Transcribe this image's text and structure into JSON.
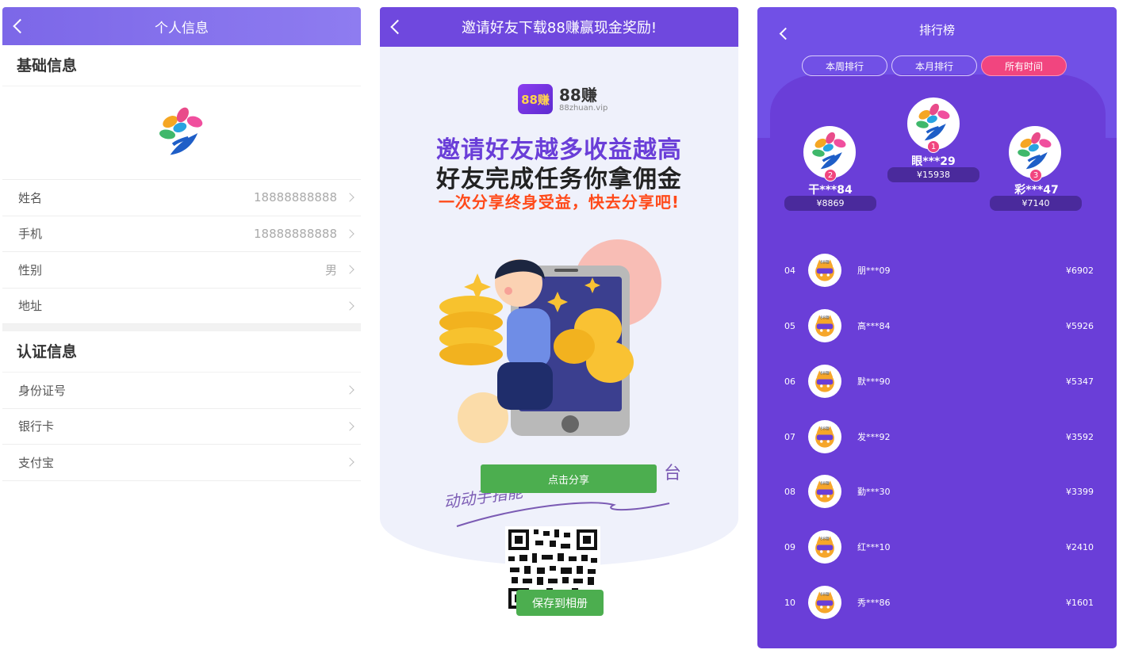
{
  "screen1": {
    "title": "个人信息",
    "basic_section": "基础信息",
    "rows": [
      {
        "label": "姓名",
        "value": "18888888888"
      },
      {
        "label": "手机",
        "value": "18888888888"
      },
      {
        "label": "性别",
        "value": "男"
      },
      {
        "label": "地址",
        "value": ""
      }
    ],
    "auth_section": "认证信息",
    "auth_rows": [
      {
        "label": "身份证号"
      },
      {
        "label": "银行卡"
      },
      {
        "label": "支付宝"
      }
    ]
  },
  "screen2": {
    "title": "邀请好友下载88赚赢现金奖励!",
    "logo_badge": "88赚",
    "logo_name": "88赚",
    "logo_url": "88zhuan.vip",
    "headline1": "邀请好友越多收益越高",
    "headline2": "好友完成任务你拿佣金",
    "headline3": "一次分享终身受益，快去分享吧!",
    "share_button": "点击分享",
    "script_text": "动动手指能",
    "script_tail": "台",
    "save_button": "保存到相册"
  },
  "screen3": {
    "title": "排行榜",
    "tabs": [
      "本周排行",
      "本月排行",
      "所有时间"
    ],
    "active_tab": 2,
    "podium": [
      {
        "rank": "1",
        "name": "眼***29",
        "amount": "¥15938"
      },
      {
        "rank": "2",
        "name": "干***84",
        "amount": "¥8869"
      },
      {
        "rank": "3",
        "name": "彩***47",
        "amount": "¥7140"
      }
    ],
    "list": [
      {
        "rank": "04",
        "name": "朋***09",
        "amount": "¥6902"
      },
      {
        "rank": "05",
        "name": "高***84",
        "amount": "¥5926"
      },
      {
        "rank": "06",
        "name": "默***90",
        "amount": "¥5347"
      },
      {
        "rank": "07",
        "name": "发***92",
        "amount": "¥3592"
      },
      {
        "rank": "08",
        "name": "勤***30",
        "amount": "¥3399"
      },
      {
        "rank": "09",
        "name": "红***10",
        "amount": "¥2410"
      },
      {
        "rank": "10",
        "name": "秀***86",
        "amount": "¥1601"
      }
    ]
  },
  "colors": {
    "purple_header": "#7c67e8",
    "purple_dark": "#6a3ed8",
    "pink_accent": "#f1457f",
    "green_button": "#4cae4f",
    "orange_text": "#ff4a1a"
  }
}
